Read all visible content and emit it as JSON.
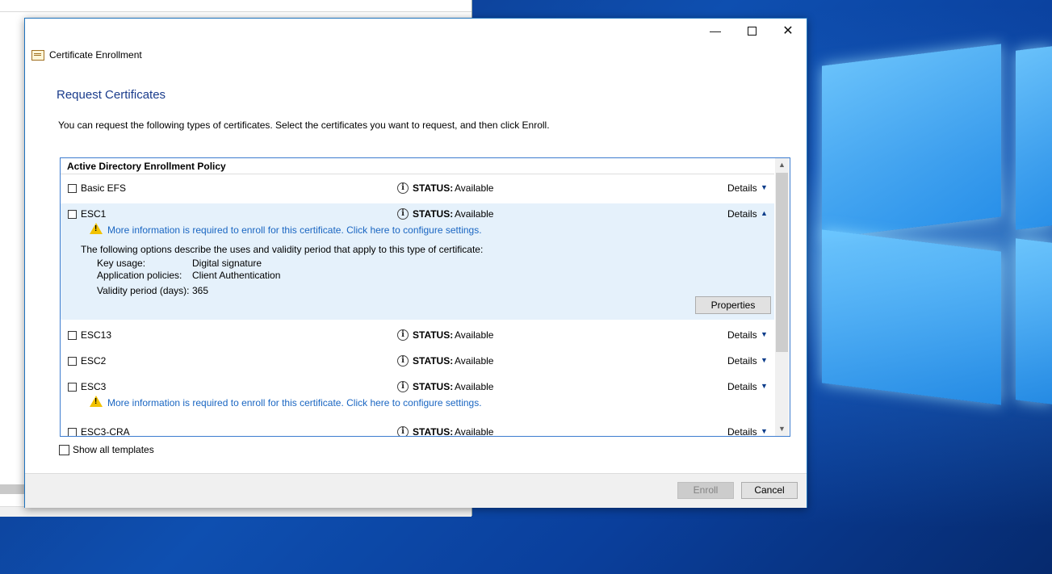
{
  "window": {
    "title": "Certificate Enrollment"
  },
  "page": {
    "heading": "Request Certificates",
    "description": "You can request the following types of certificates. Select the certificates you want to request, and then click Enroll."
  },
  "policy": {
    "header": "Active Directory Enrollment Policy"
  },
  "common": {
    "status_label": "STATUS:",
    "details_label": "Details",
    "more_info_link": "More information is required to enroll for this certificate. Click here to configure settings."
  },
  "certificates": [
    {
      "name": "Basic EFS",
      "status": "Available",
      "checked": false
    },
    {
      "name": "ESC1",
      "status": "Available",
      "checked": false,
      "expanded": true,
      "warning": true
    },
    {
      "name": "ESC13",
      "status": "Available",
      "checked": false
    },
    {
      "name": "ESC2",
      "status": "Available",
      "checked": false
    },
    {
      "name": "ESC3",
      "status": "Available",
      "checked": false,
      "warning": true
    },
    {
      "name": "ESC3-CRA",
      "status": "Available",
      "checked": false
    }
  ],
  "esc1_details": {
    "description": "The following options describe the uses and validity period that apply to this type of certificate:",
    "key_usage_label": "Key usage:",
    "key_usage_value": "Digital signature",
    "app_policies_label": "Application policies:",
    "app_policies_value": "Client Authentication",
    "validity_label": "Validity period (days):",
    "validity_value": "365",
    "properties_label": "Properties"
  },
  "show_all_label": "Show all templates",
  "buttons": {
    "enroll": "Enroll",
    "cancel": "Cancel"
  },
  "icons": {
    "minimize": "minimize-icon",
    "maximize": "maximize-icon",
    "close": "close-icon",
    "status": "info-icon",
    "warning": "warning-icon",
    "chevron_down": "chevron-down-icon",
    "chevron_up": "chevron-up-icon"
  },
  "colors": {
    "accent": "#1e73be",
    "heading": "#1a3c8c",
    "link": "#1a66c2",
    "selected_row": "#e5f1fb"
  }
}
